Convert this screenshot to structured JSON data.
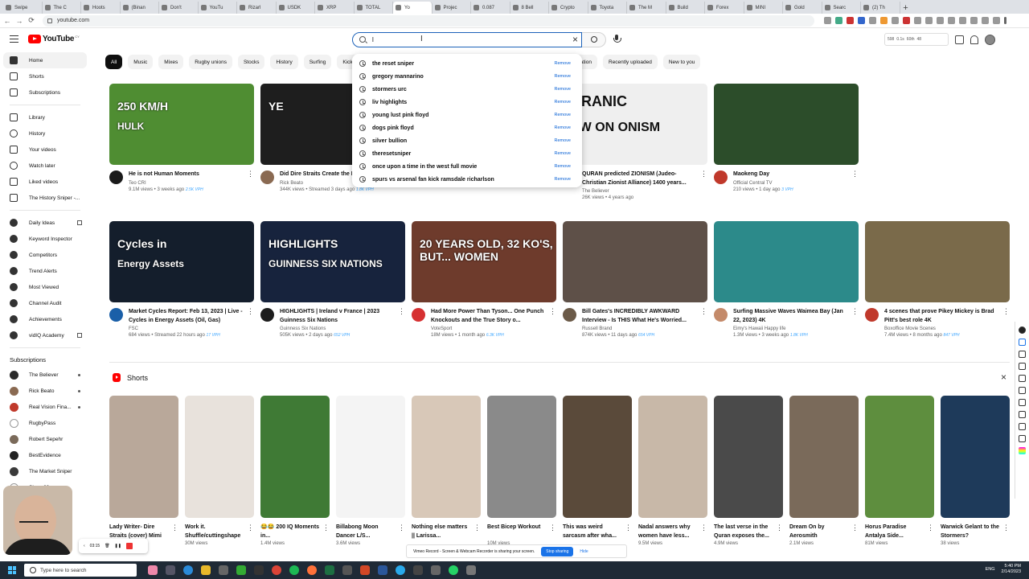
{
  "browser": {
    "tabs": [
      {
        "label": "Swipe"
      },
      {
        "label": "The C"
      },
      {
        "label": "Hoots"
      },
      {
        "label": "(Binan"
      },
      {
        "label": "Don't"
      },
      {
        "label": "YouTu"
      },
      {
        "label": "Rizarl"
      },
      {
        "label": "USDK"
      },
      {
        "label": "XRP"
      },
      {
        "label": "TOTAL"
      },
      {
        "label": "Yo"
      },
      {
        "label": "Projec"
      },
      {
        "label": "0.087"
      },
      {
        "label": "8 Bell"
      },
      {
        "label": "Crypto"
      },
      {
        "label": "Toyota"
      },
      {
        "label": "The M"
      },
      {
        "label": "Build"
      },
      {
        "label": "Forex"
      },
      {
        "label": "MINI"
      },
      {
        "label": "Gold"
      },
      {
        "label": "Searc"
      },
      {
        "label": "(2) Th"
      }
    ],
    "new_tab": "+",
    "url": "youtube.com"
  },
  "header": {
    "logo_text": "YouTube",
    "logo_sup": "CY",
    "search_value": "l",
    "clear_icon": "×",
    "vidiq": {
      "a": "598",
      "b": "0.1s",
      "c": "60th",
      "d": "48"
    }
  },
  "sidebar": {
    "main": [
      {
        "label": "Home"
      },
      {
        "label": "Shorts"
      },
      {
        "label": "Subscriptions"
      }
    ],
    "library": [
      {
        "label": "Library"
      },
      {
        "label": "History"
      },
      {
        "label": "Your videos"
      },
      {
        "label": "Watch later"
      },
      {
        "label": "Liked videos"
      },
      {
        "label": "The History Sniper -..."
      }
    ],
    "tools": [
      {
        "label": "Daily Ideas"
      },
      {
        "label": "Keyword Inspector"
      },
      {
        "label": "Competitors"
      },
      {
        "label": "Trend Alerts"
      },
      {
        "label": "Most Viewed"
      },
      {
        "label": "Channel Audit"
      },
      {
        "label": "Achievements"
      },
      {
        "label": "vidIQ Academy"
      }
    ],
    "subs_heading": "Subscriptions",
    "subs": [
      {
        "label": "The Believer",
        "color": "#2b2b2b"
      },
      {
        "label": "Rick Beato",
        "color": "#8a6a52"
      },
      {
        "label": "Real Vision Fina...",
        "color": "#c0392b"
      },
      {
        "label": "RugbyPass",
        "color": "#ffffff"
      },
      {
        "label": "Robert Sepehr",
        "color": "#7a6a5a"
      },
      {
        "label": "BestEvidence",
        "color": "#222222"
      },
      {
        "label": "The Market Sniper",
        "color": "#3a3a3a"
      },
      {
        "label": "Show 80 more",
        "color": "#ffffff"
      }
    ]
  },
  "chips": [
    "All",
    "Music",
    "Mixes",
    "Rugby unions",
    "Stocks",
    "History",
    "Surfing",
    "Kicks",
    "orts",
    "Conversation",
    "Recently uploaded",
    "New to you"
  ],
  "suggestions": {
    "remove_label": "Remove",
    "items": [
      "the reset sniper",
      "gregory mannarino",
      "stormers urc",
      "liv highlights",
      "young lust pink floyd",
      "dogs pink floyd",
      "silver bullion",
      "theresetsniper",
      "once upon a time in the west full movie",
      "spurs vs arsenal fan kick ramsdale richarlson"
    ]
  },
  "videos_row1": [
    {
      "title": "He is not Human Moments",
      "channel": "Teo CRI",
      "stats": "9.1M views • 3 weeks ago",
      "vph": "2.5K VPH",
      "overlay": "250 KM/H",
      "overlay2": "HULK",
      "bg": "#4f8d32",
      "av": "#1a1a1a"
    },
    {
      "title": "Did Dire Straits Create the Ever? Yep",
      "channel": "Rick Beato",
      "stats": "344K views • Streamed 3 days ago",
      "vph": "1.8K VPH",
      "overlay": "YE",
      "overlay2": "",
      "bg": "#1e1e1e",
      "av": "#8a6a52"
    },
    {
      "title": "",
      "channel": "Agora",
      "stats": "41K views • 5 days ago",
      "vph": "310 VPH",
      "overlay": "",
      "overlay2": "",
      "bg": "#6b5a48",
      "av": "#555555"
    },
    {
      "title": "QURAN predicted ZIONISM (Judeo-Christian Zionist Alliance) 1400 years...",
      "channel": "The Believer",
      "stats": "26K views • 4 years ago",
      "vph": "",
      "overlay": "URANIC",
      "overlay2": "EW ON ONISM",
      "bg": "#efefef",
      "av": "#2b2b2b"
    },
    {
      "title": "Maokeng Day",
      "channel": "Official Central TV",
      "stats": "210 views • 1 day ago",
      "vph": "3 VPH",
      "overlay": "",
      "overlay2": "",
      "bg": "#2c4d2a",
      "av": "#c0392b"
    }
  ],
  "videos_row2": [
    {
      "title": "Market Cycles Report: Feb 13, 2023 | Live - Cycles in Energy Assets (Oil, Gas)",
      "channel": "FSC",
      "stats": "684 views • Streamed 22 hours ago",
      "vph": "17 VPH",
      "overlay": "Cycles in",
      "overlay2": "Energy Assets",
      "bg": "#141e2c",
      "av": "#1a5fa8"
    },
    {
      "title": "HIGHLIGHTS | Ireland v France | 2023 Guinness Six Nations",
      "channel": "Guinness Six Nations",
      "stats": "505K views • 2 days ago",
      "vph": "652 VPH",
      "overlay": "HIGHLIGHTS",
      "overlay2": "GUINNESS SIX NATIONS",
      "bg": "#17233d",
      "av": "#1d1d1d"
    },
    {
      "title": "Had More Power Than Tyson... One Punch Knockouts and the True Story o...",
      "channel": "VoteSport",
      "stats": "18M views • 1 month ago",
      "vph": "6.3K VPH",
      "overlay": "20 YEARS OLD, 32 KO'S, BUT... WOMEN",
      "overlay2": "",
      "bg": "#6e3b2c",
      "av": "#d63031"
    },
    {
      "title": "Bill Gates's INCREDIBLY AWKWARD Interview - Is THIS What He's Worried...",
      "channel": "Russell Brand",
      "stats": "874K views • 11 days ago",
      "vph": "654 VPH",
      "overlay": "",
      "overlay2": "",
      "bg": "#5e5048",
      "av": "#6b5a48"
    },
    {
      "title": "Surfing Massive Waves Waimea Bay (Jan 22, 2023) 4K",
      "channel": "Eimy's Hawaii Happy life",
      "stats": "1.3M views • 3 weeks ago",
      "vph": "1.8K VPH",
      "overlay": "",
      "overlay2": "",
      "bg": "#2c8a8a",
      "av": "#c48a6a"
    },
    {
      "title": "4 scenes that prove Pikey Mickey is Brad Pitt's best role 4K",
      "channel": "Boxoffice Movie Scenes",
      "stats": "7.4M views • 8 months ago",
      "vph": "847 VPH",
      "overlay": "",
      "overlay2": "",
      "bg": "#7a6a4a",
      "av": "#c0392b"
    }
  ],
  "shorts": {
    "heading": "Shorts",
    "close": "×",
    "items": [
      {
        "title": "Lady Writer- Dire Straits (cover) Mimi",
        "views": "",
        "bg": "#b9a89a"
      },
      {
        "title": "Work it. Shuffle/cuttingshape",
        "views": "30M views",
        "bg": "#e8e2dc"
      },
      {
        "title": "😂😂 200 IQ Moments in...",
        "views": "1.4M views",
        "bg": "#3f7a35"
      },
      {
        "title": "Billabong Moon Dancer L/S...",
        "views": "3.6M views",
        "bg": "#f4f4f4"
      },
      {
        "title": "Nothing else matters || Larissa...",
        "views": "",
        "bg": "#d8c8b8"
      },
      {
        "title": "Best Bicep Workout",
        "views": "10M views",
        "bg": "#8a8a8a"
      },
      {
        "title": "This was weird sarcasm after wha...",
        "views": "",
        "bg": "#5a4a3a"
      },
      {
        "title": "Nadal answers why women have less...",
        "views": "9.5M views",
        "bg": "#c8b8a8"
      },
      {
        "title": "The last verse in the Quran exposes the...",
        "views": "4.9M views",
        "bg": "#4a4a4a"
      },
      {
        "title": "Dream On by Aerosmith",
        "views": "2.1M views",
        "bg": "#7a6a5a"
      },
      {
        "title": "Horus Paradise Antalya Side...",
        "views": "81M views",
        "bg": "#5e8e3e"
      },
      {
        "title": "Warwick Gelant to the Stormers?",
        "views": "38 views",
        "bg": "#1e3a5a"
      }
    ]
  },
  "recorder": {
    "time": "03:15"
  },
  "vimeo": {
    "text": "Vimeo Record - Screen & Webcam Recorder is sharing your screen.",
    "stop": "Stop sharing",
    "hide": "Hide"
  },
  "taskbar": {
    "search": "Type here to search",
    "time": "5:40 PM",
    "date": "2/14/2023",
    "lang": "ENG"
  }
}
